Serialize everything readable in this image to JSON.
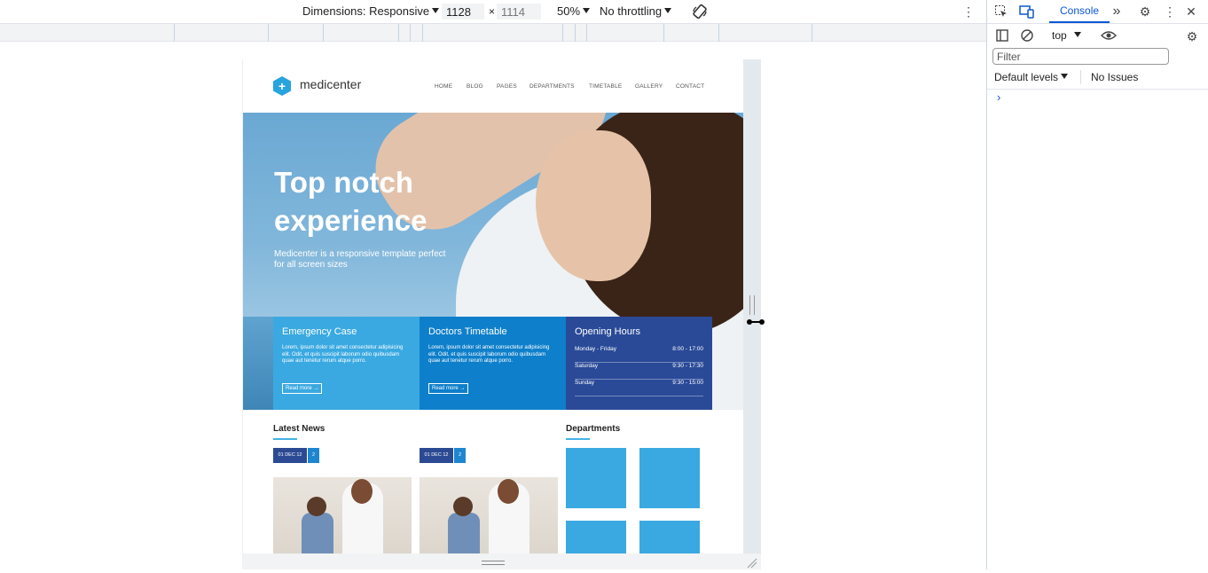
{
  "device_toolbar": {
    "dimensions_label": "Dimensions: Responsive",
    "width": "1128",
    "times": "×",
    "height": "1114",
    "zoom": "50%",
    "throttling": "No throttling"
  },
  "site": {
    "logo": "medicenter",
    "nav": [
      "HOME",
      "BLOG",
      "PAGES",
      "DEPARTMENTS",
      "TIMETABLE",
      "GALLERY",
      "CONTACT"
    ],
    "hero": {
      "title_line1": "Top notch",
      "title_line2": "experience",
      "subtitle": "Medicenter is a responsive template perfect for all screen sizes"
    },
    "boxes": [
      {
        "title": "Emergency Case",
        "text": "Lorem, ipsum dolor sit amet consectetur adipisicing elit. Odit, et quis suscipit laborum odio quibusdam quae aut tenetur rerum atque porro.",
        "button": "Read more →",
        "color": "#3aa9e1"
      },
      {
        "title": "Doctors Timetable",
        "text": "Lorem, ipsum dolor sit amet consectetur adipisicing elit. Odit, et quis suscipit laborum odio quibusdam quae aut tenetur rerum atque porro.",
        "button": "Read more →",
        "color": "#0e7fca"
      },
      {
        "title": "Opening Hours",
        "color": "#2a4a98",
        "hours": [
          {
            "day": "Monday - Friday",
            "time": "8:00 - 17:00"
          },
          {
            "day": "Saturday",
            "time": "9:30 - 17:30"
          },
          {
            "day": "Sunday",
            "time": "9:30 - 15:00"
          }
        ]
      }
    ],
    "latest_news": {
      "title": "Latest News",
      "items": [
        {
          "date": "01 DEC 12",
          "comments": "2"
        },
        {
          "date": "01 DEC 12",
          "comments": "2"
        }
      ]
    },
    "departments": {
      "title": "Departments"
    }
  },
  "devtools": {
    "console_tab": "Console",
    "context": "top",
    "filter_placeholder": "Filter",
    "levels": "Default levels",
    "issues": "No Issues",
    "prompt": "›",
    "more_tabs": "»",
    "close": "✕"
  }
}
